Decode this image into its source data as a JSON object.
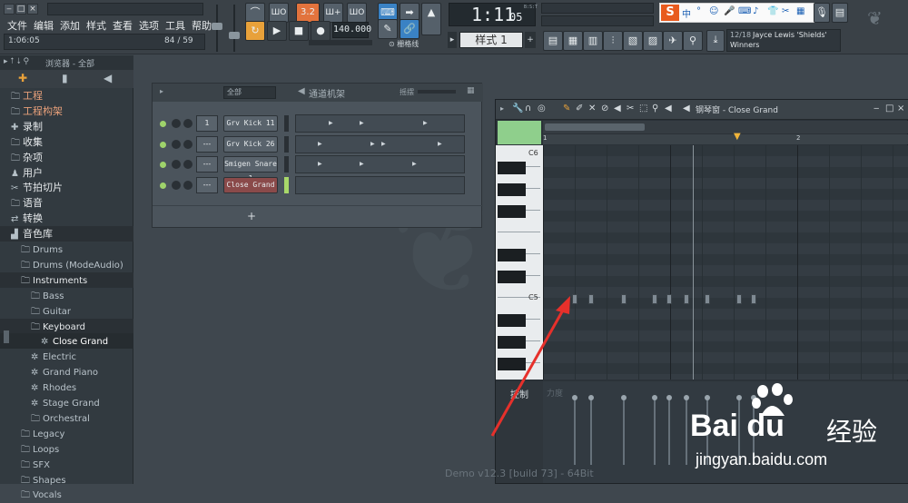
{
  "menu": [
    "文件",
    "编辑",
    "添加",
    "样式",
    "查看",
    "选项",
    "工具",
    "帮助"
  ],
  "time_small": "1:06:05",
  "counter": "84 / 59",
  "pattern_num": "3.2",
  "tempo": "140.000",
  "time_big": "1:11",
  "time_big_sub": "05",
  "time_label": "B:S:T",
  "pattern_label": "样式 1",
  "snap_label": "栅格线",
  "ime_icons": [
    "中",
    "°",
    "☺",
    "⌨",
    "♪"
  ],
  "news": {
    "count": "12/18",
    "artist": "Jayce Lewis 'Shields'",
    "title": "Winners"
  },
  "browser": {
    "header": "浏览器 - 全部",
    "items": [
      {
        "label": "工程",
        "icon": "folder-icon",
        "color": "#e8a07a",
        "indent": 0
      },
      {
        "label": "工程构架",
        "icon": "folder-icon",
        "color": "#e8a07a",
        "indent": 0
      },
      {
        "label": "录制",
        "icon": "record-icon",
        "color": "#e6e9eb",
        "indent": 0
      },
      {
        "label": "收集",
        "icon": "folder-icon",
        "color": "#e6e9eb",
        "indent": 0
      },
      {
        "label": "杂项",
        "icon": "folder-icon",
        "color": "#e6e9eb",
        "indent": 0
      },
      {
        "label": "用户",
        "icon": "user-icon",
        "color": "#e6e9eb",
        "indent": 0
      },
      {
        "label": "节拍切片",
        "icon": "slice-icon",
        "color": "#e6e9eb",
        "indent": 0
      },
      {
        "label": "语音",
        "icon": "folder-icon",
        "color": "#e6e9eb",
        "indent": 0
      },
      {
        "label": "转换",
        "icon": "convert-icon",
        "color": "#e6e9eb",
        "indent": 0
      },
      {
        "label": "音色库",
        "icon": "library-icon",
        "color": "#e6e9eb",
        "indent": 0,
        "selected": true
      },
      {
        "label": "Drums",
        "icon": "folder-icon",
        "color": "#b9c3ca",
        "indent": 1
      },
      {
        "label": "Drums (ModeAudio)",
        "icon": "folder-icon",
        "color": "#b9c3ca",
        "indent": 1
      },
      {
        "label": "Instruments",
        "icon": "folder-icon",
        "color": "#e6e9eb",
        "indent": 1,
        "selected": true
      },
      {
        "label": "Bass",
        "icon": "folder-icon",
        "color": "#b9c3ca",
        "indent": 2
      },
      {
        "label": "Guitar",
        "icon": "folder-icon",
        "color": "#b9c3ca",
        "indent": 2
      },
      {
        "label": "Keyboard",
        "icon": "folder-icon",
        "color": "#e6e9eb",
        "indent": 2,
        "selected": true
      },
      {
        "label": "Close Grand",
        "icon": "plugin-icon",
        "color": "#ffffff",
        "indent": 3,
        "highlight": true
      },
      {
        "label": "Electric",
        "icon": "plugin-icon",
        "color": "#b9c3ca",
        "indent": 2
      },
      {
        "label": "Grand Piano",
        "icon": "plugin-icon",
        "color": "#b9c3ca",
        "indent": 2
      },
      {
        "label": "Rhodes",
        "icon": "plugin-icon",
        "color": "#b9c3ca",
        "indent": 2
      },
      {
        "label": "Stage Grand",
        "icon": "plugin-icon",
        "color": "#b9c3ca",
        "indent": 2
      },
      {
        "label": "Orchestral",
        "icon": "folder-icon",
        "color": "#b9c3ca",
        "indent": 2
      },
      {
        "label": "Legacy",
        "icon": "folder-icon",
        "color": "#b9c3ca",
        "indent": 1
      },
      {
        "label": "Loops",
        "icon": "folder-icon",
        "color": "#b9c3ca",
        "indent": 1
      },
      {
        "label": "SFX",
        "icon": "folder-icon",
        "color": "#b9c3ca",
        "indent": 1
      },
      {
        "label": "Shapes",
        "icon": "folder-icon",
        "color": "#b9c3ca",
        "indent": 1
      },
      {
        "label": "Vocals",
        "icon": "folder-icon",
        "color": "#b9c3ca",
        "indent": 1
      }
    ]
  },
  "rack": {
    "filter": "全部",
    "title": "通道机架",
    "swing": "摇摆",
    "channels": [
      {
        "num": "1",
        "name": "Grv Kick 11",
        "red": false
      },
      {
        "num": "---",
        "name": "Grv Kick 26",
        "red": false
      },
      {
        "num": "---",
        "name": "Smigen Snare 1",
        "red": false
      },
      {
        "num": "---",
        "name": "Close Grand",
        "red": true
      }
    ],
    "add": "+"
  },
  "pianoroll": {
    "title": "钢琴窗 - Close Grand",
    "c6": "C6",
    "c5": "C5",
    "bar1": "1",
    "bar2": "2",
    "control": "控制",
    "velocity": "力度"
  },
  "footer": "Demo v12.3 [build 73] - 64Bit",
  "watermark": {
    "brand": "Bai du",
    "cn": "经验",
    "url": "jingyan.baidu.com"
  }
}
